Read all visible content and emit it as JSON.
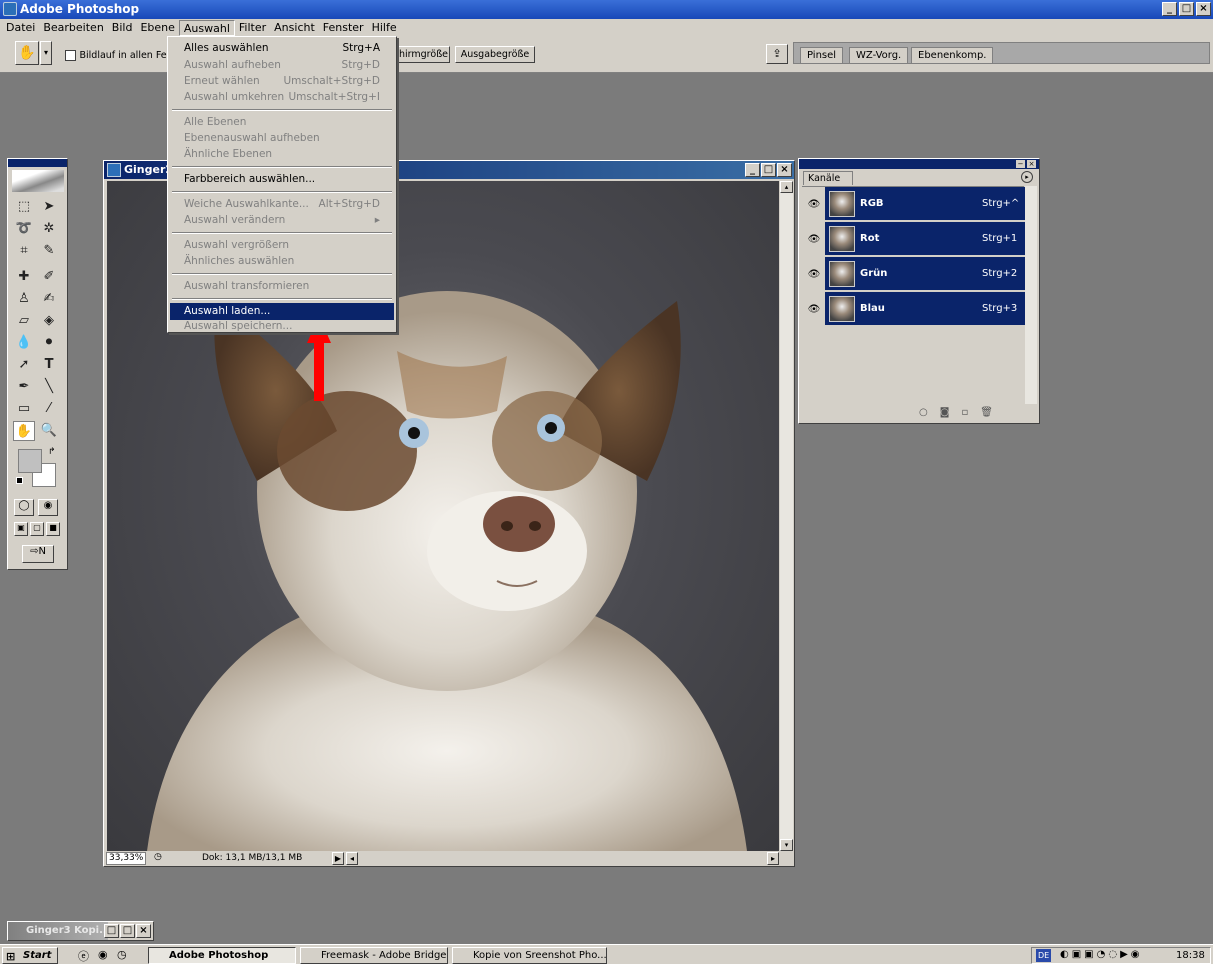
{
  "app": {
    "title": "Adobe Photoshop"
  },
  "window_controls": {
    "minimize": "_",
    "maximize": "□",
    "close": "×"
  },
  "menubar": {
    "items": [
      "Datei",
      "Bearbeiten",
      "Bild",
      "Ebene",
      "Auswahl",
      "Filter",
      "Ansicht",
      "Fenster",
      "Hilfe"
    ],
    "active": "Auswahl"
  },
  "options_bar": {
    "scroll_all_label": "Bildlauf in allen Fens",
    "screen_size_button": "hirmgröße",
    "print_size_button": "Ausgabegröße"
  },
  "palette_well": {
    "tabs": [
      "Pinsel",
      "WZ-Vorg.",
      "Ebenenkomp."
    ]
  },
  "auswahl_menu": {
    "groups": [
      [
        {
          "label": "Alles auswählen",
          "shortcut": "Strg+A",
          "enabled": true
        },
        {
          "label": "Auswahl aufheben",
          "shortcut": "Strg+D",
          "enabled": false
        },
        {
          "label": "Erneut wählen",
          "shortcut": "Umschalt+Strg+D",
          "enabled": false
        },
        {
          "label": "Auswahl umkehren",
          "shortcut": "Umschalt+Strg+I",
          "enabled": false
        }
      ],
      [
        {
          "label": "Alle Ebenen",
          "shortcut": "",
          "enabled": false
        },
        {
          "label": "Ebenenauswahl aufheben",
          "shortcut": "",
          "enabled": false
        },
        {
          "label": "Ähnliche Ebenen",
          "shortcut": "",
          "enabled": false
        }
      ],
      [
        {
          "label": "Farbbereich auswählen...",
          "shortcut": "",
          "enabled": true
        }
      ],
      [
        {
          "label": "Weiche Auswahlkante...",
          "shortcut": "Alt+Strg+D",
          "enabled": false
        },
        {
          "label": "Auswahl verändern",
          "shortcut": "▸",
          "enabled": false
        }
      ],
      [
        {
          "label": "Auswahl vergrößern",
          "shortcut": "",
          "enabled": false
        },
        {
          "label": "Ähnliches auswählen",
          "shortcut": "",
          "enabled": false
        }
      ],
      [
        {
          "label": "Auswahl transformieren",
          "shortcut": "",
          "enabled": false
        }
      ],
      [
        {
          "label": "Auswahl laden...",
          "shortcut": "",
          "enabled": true,
          "highlighted": true
        },
        {
          "label": "Auswahl speichern...",
          "shortcut": "",
          "enabled": false
        }
      ]
    ]
  },
  "document": {
    "title": "Ginger2",
    "zoom": "33,33%",
    "doc_info": "Dok: 13,1 MB/13,1 MB"
  },
  "channels_panel": {
    "tab": "Kanäle",
    "channels": [
      {
        "name": "RGB",
        "shortcut": "Strg+^"
      },
      {
        "name": "Rot",
        "shortcut": "Strg+1"
      },
      {
        "name": "Grün",
        "shortcut": "Strg+2"
      },
      {
        "name": "Blau",
        "shortcut": "Strg+3"
      }
    ]
  },
  "minimized_window": {
    "title": "Ginger3 Kopi..."
  },
  "taskbar": {
    "start_label": "Start",
    "tasks": [
      "Adobe Photoshop",
      "Freemask - Adobe Bridge",
      "Kopie von Sreenshot Pho..."
    ],
    "active_task": "Adobe Photoshop",
    "tray_lang": "DE",
    "clock": "18:38"
  },
  "colors": {
    "accent": "#0a246a",
    "highlight": "#0a246a",
    "arrow": "#ff0000",
    "title_bar": "#1848b8"
  }
}
